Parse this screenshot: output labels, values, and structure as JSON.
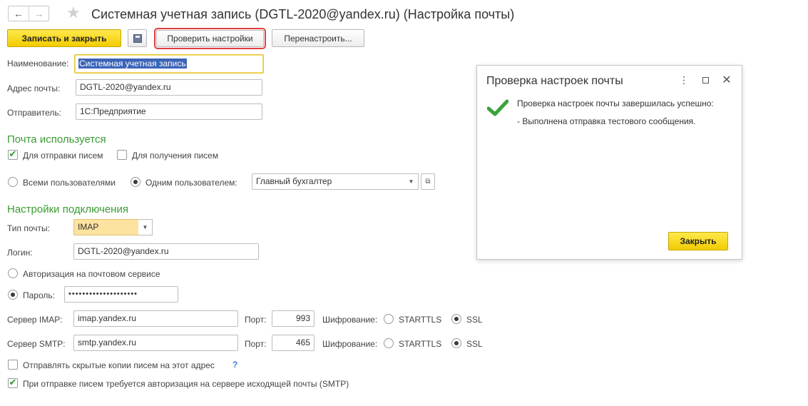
{
  "header": {
    "back_icon": "arrow-left-icon",
    "forward_icon": "arrow-right-icon",
    "favorite_icon": "star-icon",
    "title": "Системная учетная запись (DGTL-2020@yandex.ru) (Настройка почты)"
  },
  "toolbar": {
    "save_close_label": "Записать и закрыть",
    "save_icon": "floppy-disk-icon",
    "check_settings_label": "Проверить настройки",
    "reconfigure_label": "Перенастроить..."
  },
  "form": {
    "name_label": "Наименование:",
    "name_value": "Системная учетная запись",
    "email_label": "Адрес почты:",
    "email_value": "DGTL-2020@yandex.ru",
    "sender_label": "Отправитель:",
    "sender_value": "1С:Предприятие",
    "usage_section": "Почта используется",
    "send_label": "Для отправки писем",
    "send_checked": true,
    "receive_label": "Для получения писем",
    "receive_checked": false,
    "all_users_label": "Всеми пользователями",
    "one_user_label": "Одним пользователем:",
    "user_scope_selected": "one",
    "user_value": "Главный бухгалтер",
    "connection_section": "Настройки подключения",
    "mail_type_label": "Тип почты:",
    "mail_type_value": "IMAP",
    "login_label": "Логин:",
    "login_value": "DGTL-2020@yandex.ru",
    "auth_service_label": "Авторизация на почтовом сервисе",
    "password_label": "Пароль:",
    "password_value": "••••••••••••••••••••",
    "auth_selected": "password",
    "imap_label": "Сервер IMAP:",
    "imap_value": "imap.yandex.ru",
    "imap_port_label": "Порт:",
    "imap_port_value": "993",
    "imap_enc_label": "Шифрование:",
    "imap_enc_starttls": "STARTTLS",
    "imap_enc_ssl": "SSL",
    "imap_enc_selected": "SSL",
    "smtp_label": "Сервер SMTP:",
    "smtp_value": "smtp.yandex.ru",
    "smtp_port_label": "Порт:",
    "smtp_port_value": "465",
    "smtp_enc_label": "Шифрование:",
    "smtp_enc_starttls": "STARTTLS",
    "smtp_enc_ssl": "SSL",
    "smtp_enc_selected": "SSL",
    "bcc_label": "Отправлять скрытые копии писем на этот адрес",
    "bcc_checked": false,
    "bcc_help": "?",
    "smtp_auth_label": "При отправке писем требуется авторизация на сервере исходящей почты (SMTP)",
    "smtp_auth_checked": true
  },
  "dialog": {
    "title": "Проверка настроек почты",
    "more_icon": "more-vertical-icon",
    "maximize_icon": "maximize-icon",
    "close_icon": "close-icon",
    "status_icon": "checkmark-icon",
    "message_line1": "Проверка настроек почты завершилась успешно:",
    "message_line2": "- Выполнена отправка тестового сообщения.",
    "close_label": "Закрыть"
  },
  "colors": {
    "accent_yellow": "#f2cc00",
    "section_green": "#3b9b35",
    "check_green": "#2d9a2d",
    "highlight_red": "#e04040"
  }
}
